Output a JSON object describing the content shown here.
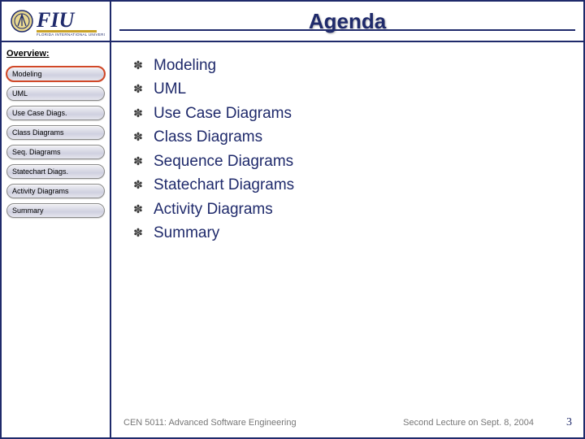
{
  "title": "Agenda",
  "sidebar": {
    "heading": "Overview:",
    "items": [
      {
        "label": "Modeling",
        "highlight": true
      },
      {
        "label": "UML",
        "highlight": false
      },
      {
        "label": "Use Case Diags.",
        "highlight": false
      },
      {
        "label": "Class Diagrams",
        "highlight": false
      },
      {
        "label": "Seq. Diagrams",
        "highlight": false
      },
      {
        "label": "Statechart Diags.",
        "highlight": false
      },
      {
        "label": "Activity Diagrams",
        "highlight": false
      },
      {
        "label": "Summary",
        "highlight": false
      }
    ]
  },
  "agenda_items": [
    "Modeling",
    "UML",
    "Use Case Diagrams",
    "Class Diagrams",
    "Sequence Diagrams",
    "Statechart Diagrams",
    "Activity Diagrams",
    "Summary"
  ],
  "footer": {
    "course": "CEN 5011: Advanced Software Engineering",
    "lecture": "Second Lecture on Sept. 8, 2004",
    "page": "3"
  }
}
